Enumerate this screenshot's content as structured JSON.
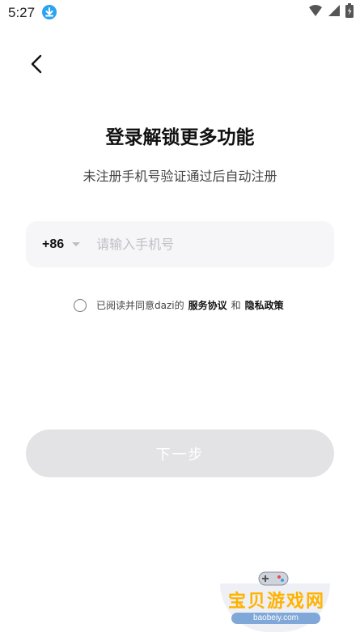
{
  "status_bar": {
    "time": "5:27",
    "icons": [
      "download-icon",
      "wifi-icon",
      "cellular-signal-icon",
      "battery-charging-icon"
    ]
  },
  "header": {
    "back_icon": "chevron-left-icon"
  },
  "login": {
    "title": "登录解锁更多功能",
    "subtitle": "未注册手机号验证通过后自动注册",
    "country_code": "+86",
    "phone_placeholder": "请输入手机号",
    "phone_value": "",
    "agreement": {
      "prefix": "已阅读并同意dazi的",
      "service_link": "服务协议",
      "conjunction": "和",
      "privacy_link": "隐私政策",
      "checked": false
    },
    "next_button": "下一步"
  },
  "watermark": {
    "text": "宝贝游戏网",
    "url": "baobeiy.com"
  },
  "colors": {
    "accent_download": "#2aa3f0",
    "input_bg": "#f6f5f8",
    "button_disabled": "#e3e3e6",
    "watermark_text": "#ffb300"
  }
}
